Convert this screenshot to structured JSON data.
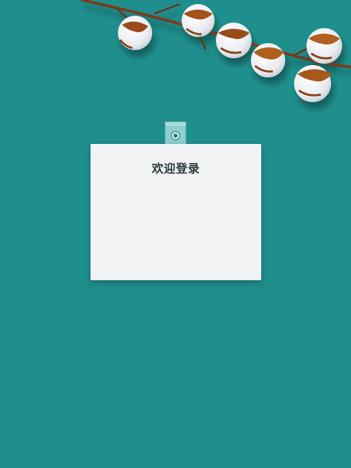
{
  "login": {
    "title": "欢迎登录"
  },
  "colors": {
    "background": "#1f8f8e",
    "card": "#f0f2f4",
    "title_text": "#2d3a3e",
    "clip": "#8ccfd0",
    "branch": "#7a3b1a"
  },
  "icons": {
    "decoration": "cotton-branch-icon",
    "clip": "paper-clip-icon"
  }
}
